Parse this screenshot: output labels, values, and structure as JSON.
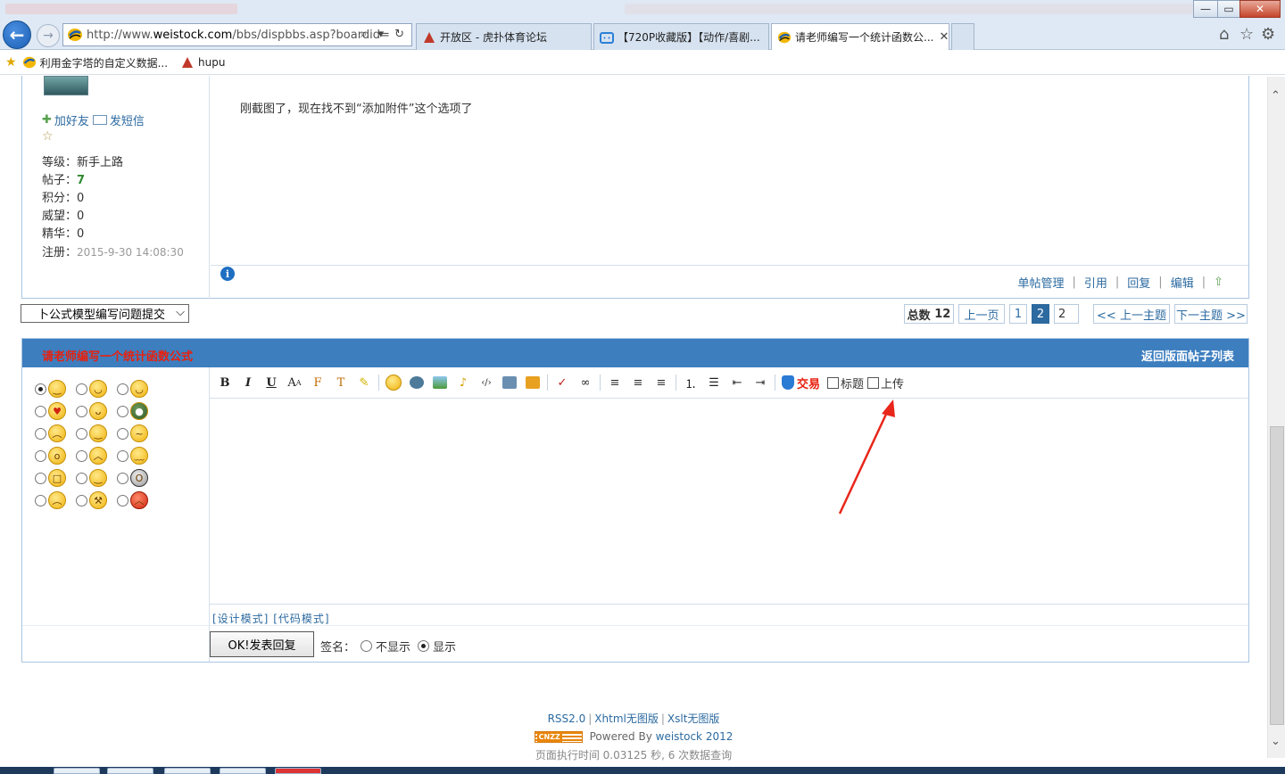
{
  "browser": {
    "address_url_prefix": "http://www.",
    "address_url_domain": "weistock.com",
    "address_url_rest": "/bbs/dispbbs.asp?boardid=",
    "address_tools": "⌕ ▾ ↻",
    "tabs": [
      {
        "label": "开放区 - 虎扑体育论坛",
        "icon_color": "#c0392b"
      },
      {
        "label": "【720P收藏版】【动作/喜剧...",
        "icon_color": "#2b7fd6"
      },
      {
        "label": "请老师编写一个统计函数公...",
        "icon_color": "#f2b705"
      }
    ],
    "tab_close": "✕",
    "home_icon": "⌂",
    "fav_star_icon": "☆",
    "settings_icon": "⚙",
    "win_minimize": "—",
    "win_maximize": "▭",
    "win_close": "✕"
  },
  "favorites": [
    {
      "label": "利用金字塔的自定义数据..."
    },
    {
      "label": "hupu"
    }
  ],
  "post": {
    "add_friend": "加好友",
    "send_message": "发短信",
    "star": "☆",
    "level_label": "等级：",
    "level_value": "新手上路",
    "posts_label": "帖子：",
    "posts_value": "7",
    "points_label": "积分：",
    "points_value": "0",
    "prestige_label": "威望：",
    "prestige_value": "0",
    "essence_label": "精华：",
    "essence_value": "0",
    "registered_label": "注册：",
    "registered_value": "2015-9-30 14:08:30",
    "body": "刚截图了，现在找不到“添加附件”这个选项了",
    "info_icon": "i",
    "actions": [
      "单帖管理",
      "引用",
      "回复",
      "编辑"
    ],
    "top_icon": "⇧"
  },
  "navigation": {
    "jump_select": "卜公式模型编写问题提交",
    "total_label": "总数",
    "total_value": "12",
    "prev_page": "上一页",
    "pages": [
      "1",
      "2"
    ],
    "current_page": "2",
    "page_input": "2",
    "prev_topic": "<< 上一主题",
    "next_topic": "下一主题 >>"
  },
  "reply": {
    "topic_title": "请老师编写一个统计函数公式",
    "back_to_list": "返回版面帖子列表",
    "toolbar": {
      "bold": "B",
      "italic": "I",
      "underline": "U",
      "trade_label": "交易",
      "title_checkbox": "标题",
      "upload_checkbox": "上传"
    },
    "design_mode": "[设计模式]",
    "code_mode": "[代码模式]",
    "submit": "OK!发表回复",
    "signature_label": "签名：",
    "sig_hide": "不显示",
    "sig_show": "显示",
    "sig_selected": "显示"
  },
  "footer": {
    "rss": "RSS2.0",
    "xhtml": "Xhtml无图版",
    "xslt": "Xslt无图版",
    "cnzz": "CNZZ",
    "powered_by": "Powered By",
    "powered_link": "weistock 2012",
    "exec_time": "页面执行时间 0.03125 秒, 6 次数据查询"
  },
  "colors": {
    "header_blue": "#3d7ebf",
    "title_red": "#e8200d",
    "link_blue": "#2c6aa0",
    "annotation_arrow": "#e8261a"
  }
}
